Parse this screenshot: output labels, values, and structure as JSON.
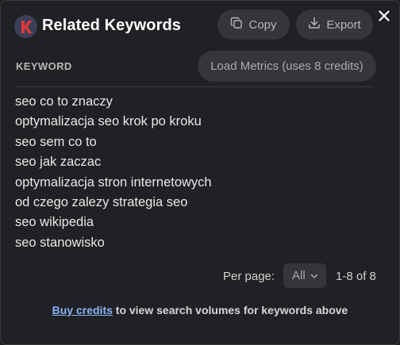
{
  "header": {
    "logo_letter": "K",
    "title": "Related Keywords",
    "copy_label": "Copy",
    "export_label": "Export",
    "close_label": "✕"
  },
  "table": {
    "column_header": "KEYWORD",
    "load_metrics_label": "Load Metrics (uses 8 credits)",
    "keywords": [
      "seo co to znaczy",
      "optymalizacja seo krok po kroku",
      "seo sem co to",
      "seo jak zaczac",
      "optymalizacja stron internetowych",
      "od czego zalezy strategia seo",
      "seo wikipedia",
      "seo stanowisko"
    ]
  },
  "pagination": {
    "per_page_label": "Per page:",
    "per_page_value": "All",
    "range_text": "1-8 of 8"
  },
  "footer": {
    "link_text": "Buy credits",
    "rest_text": " to view search volumes for keywords above"
  },
  "colors": {
    "background": "#202124",
    "button_bg": "#35363a",
    "link": "#8ab4f8",
    "logo_bg": "#3c3f57",
    "logo_letter": "#e0393e"
  },
  "icons": {
    "logo": "k-logo-icon",
    "copy": "copy-icon",
    "export": "download-icon",
    "close": "close-icon",
    "select": "chevron-down-icon"
  }
}
